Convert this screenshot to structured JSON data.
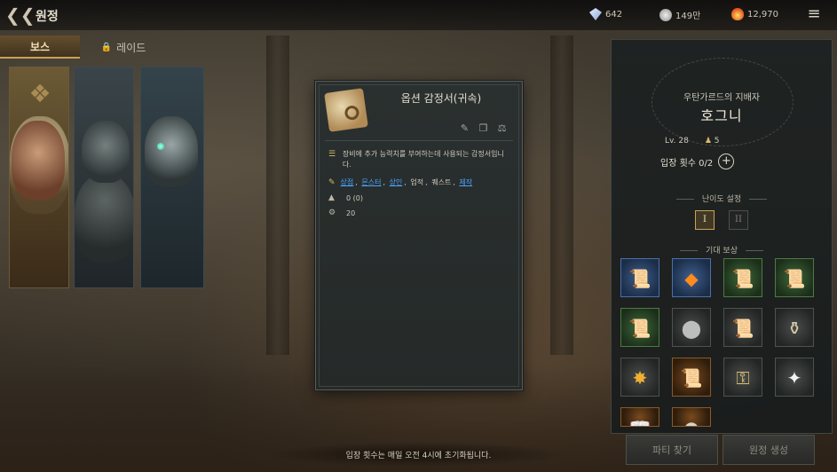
{
  "header": {
    "title": "원정",
    "resources": [
      {
        "icon": "diamond-icon",
        "value": "642"
      },
      {
        "icon": "silver-coin-icon",
        "value": "149만"
      },
      {
        "icon": "flame-gem-icon",
        "value": "12,970"
      }
    ]
  },
  "tabs": [
    {
      "label": "보스",
      "active": true
    },
    {
      "label": "레이드",
      "locked": true
    }
  ],
  "tooltip": {
    "title": "옵션 감정서(귀속)",
    "description": "장비에 추가 능력치를 부여하는데 사용되는 감정서입니다.",
    "sources": [
      {
        "label": "상점",
        "link": true
      },
      {
        "label": "몬스터",
        "link": true
      },
      {
        "label": "상인",
        "link": true
      },
      {
        "label": "업적",
        "link": false
      },
      {
        "label": "퀘스트",
        "link": false
      },
      {
        "label": "제작",
        "link": true
      }
    ],
    "source_separator": ",",
    "stat_count": "0 (0)",
    "stat_weight": "20"
  },
  "panel": {
    "subtitle": "우탄가르드의 지배자",
    "boss_name": "호그니",
    "level": "Lv. 28",
    "party_size": "5",
    "entry_count": "입장 횟수 0/2",
    "difficulty_label": "난이도 설정",
    "difficulty_1": "I",
    "difficulty_2": "II",
    "rewards_label": "기대 보상",
    "party_button": "파티 찾기",
    "create_button": "원정 생성"
  },
  "footer": "입장 횟수는 매일 오전 4시에 초기화됩니다.",
  "colors": {
    "accent": "#c9a15a",
    "link": "#4ba3ff"
  }
}
